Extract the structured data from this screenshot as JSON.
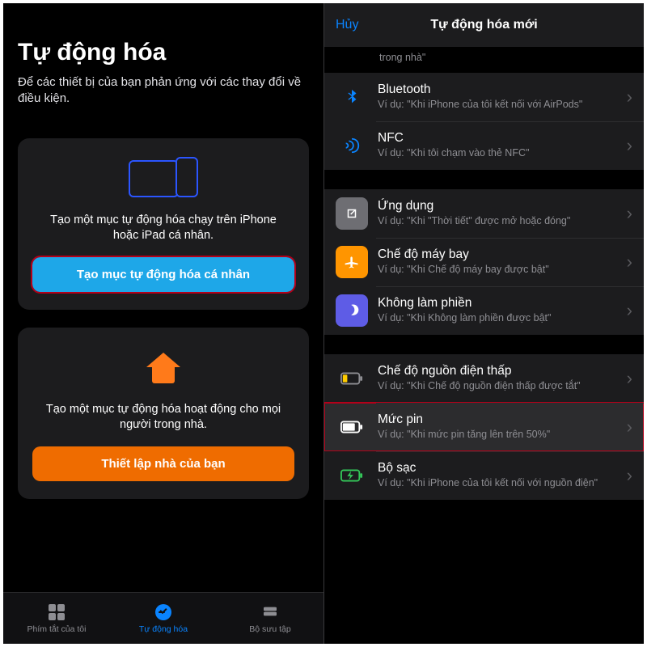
{
  "left": {
    "title": "Tự động hóa",
    "subtitle": "Để các thiết bị của bạn phản ứng với các thay đổi về điều kiện.",
    "card_personal": {
      "desc": "Tạo một mục tự động hóa chạy trên iPhone hoặc iPad cá nhân.",
      "button": "Tạo mục tự động hóa cá nhân"
    },
    "card_home": {
      "desc": "Tạo một mục tự động hóa hoạt động cho mọi người trong nhà.",
      "button": "Thiết lập nhà của bạn"
    },
    "tabs": {
      "shortcuts": "Phím tắt của tôi",
      "automation": "Tự động hóa",
      "gallery": "Bộ sưu tập"
    }
  },
  "right": {
    "cancel": "Hủy",
    "title": "Tự động hóa mới",
    "partial_tail": "trong nhà\"",
    "rows": {
      "bluetooth": {
        "title": "Bluetooth",
        "sub": "Ví dụ: \"Khi iPhone của tôi kết nối với AirPods\""
      },
      "nfc": {
        "title": "NFC",
        "sub": "Ví dụ: \"Khi tôi chạm vào thẻ NFC\""
      },
      "app": {
        "title": "Ứng dụng",
        "sub": "Ví dụ: \"Khi \"Thời tiết\" được mở hoặc đóng\""
      },
      "airplane": {
        "title": "Chế độ máy bay",
        "sub": "Ví dụ: \"Khi Chế độ máy bay được bật\""
      },
      "dnd": {
        "title": "Không làm phiền",
        "sub": "Ví dụ: \"Khi Không làm phiền được bật\""
      },
      "lowpower": {
        "title": "Chế độ nguồn điện thấp",
        "sub": "Ví dụ: \"Khi Chế độ nguồn điện thấp được tắt\""
      },
      "battery": {
        "title": "Mức pin",
        "sub": "Ví dụ: \"Khi mức pin tăng lên trên 50%\""
      },
      "charger": {
        "title": "Bộ sạc",
        "sub": "Ví dụ: \"Khi iPhone của tôi kết nối với nguồn điện\""
      }
    }
  }
}
